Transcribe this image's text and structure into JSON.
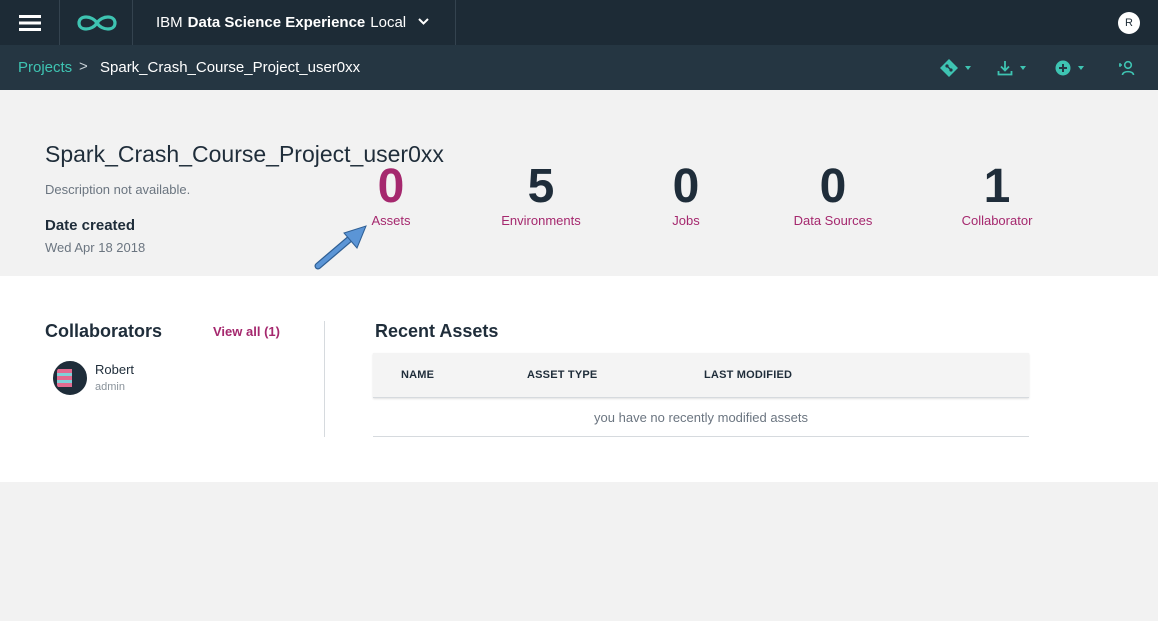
{
  "topbar": {
    "menu_icon": "hamburger-menu-icon",
    "logo_icon": "infinity-logo-icon",
    "title_prefix": "IBM",
    "title_bold": "Data Science Experience",
    "title_suffix": "Local",
    "user_initial": "R"
  },
  "breadcrumb": {
    "root": "Projects",
    "separator": ">",
    "current": "Spark_Crash_Course_Project_user0xx"
  },
  "project": {
    "name": "Spark_Crash_Course_Project_user0xx",
    "description": "Description not available.",
    "date_label": "Date created",
    "date_value": "Wed Apr 18 2018"
  },
  "stats": [
    {
      "value": "0",
      "label": "Assets"
    },
    {
      "value": "5",
      "label": "Environments"
    },
    {
      "value": "0",
      "label": "Jobs"
    },
    {
      "value": "0",
      "label": "Data Sources"
    },
    {
      "value": "1",
      "label": "Collaborator"
    }
  ],
  "collaborators": {
    "title": "Collaborators",
    "view_all": "View all (1)",
    "items": [
      {
        "name": "Robert",
        "role": "admin"
      }
    ]
  },
  "recent_assets": {
    "title": "Recent Assets",
    "columns": [
      "NAME",
      "ASSET TYPE",
      "LAST MODIFIED"
    ],
    "empty_message": "you have no recently modified assets"
  },
  "colors": {
    "topbar": "#1d2b36",
    "breadcrumb_bar": "#253642",
    "accent_teal": "#3ec4b2",
    "accent_magenta": "#a5286e",
    "arrow_blue": "#4a86c8"
  }
}
